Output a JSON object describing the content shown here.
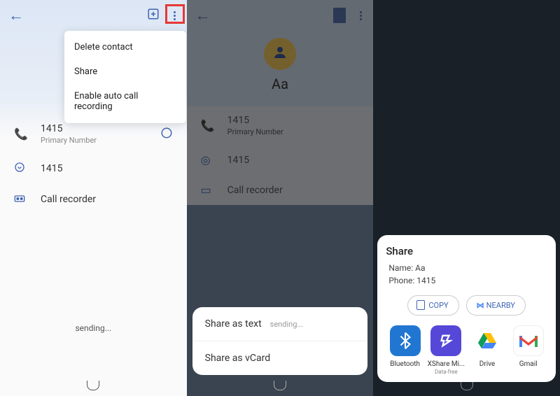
{
  "panel1": {
    "dropdown": {
      "delete": "Delete contact",
      "share": "Share",
      "auto_rec": "Enable auto call recording"
    },
    "rows": {
      "phone_num": "1415",
      "phone_sub": "Primary Number",
      "whatsapp_num": "1415",
      "recorder": "Call recorder"
    },
    "sending": "sending..."
  },
  "panel2": {
    "contact_name": "Aa",
    "rows": {
      "phone_num": "1415",
      "phone_sub": "Primary Number",
      "whatsapp_num": "1415",
      "recorder": "Call recorder"
    },
    "sheet": {
      "share_text": "Share as text",
      "share_sending": "sending...",
      "share_vcard": "Share as vCard"
    }
  },
  "panel3": {
    "share_title": "Share",
    "info_name_label": "Name: ",
    "info_name": "Aa",
    "info_phone_label": "Phone: ",
    "info_phone": "1415",
    "copy_btn": "COPY",
    "nearby_btn": "NEARBY",
    "apps": {
      "bluetooth": "Bluetooth",
      "xshare": "XShare Mi...",
      "xshare_sub": "Data-free",
      "drive": "Drive",
      "gmail": "Gmail"
    }
  }
}
